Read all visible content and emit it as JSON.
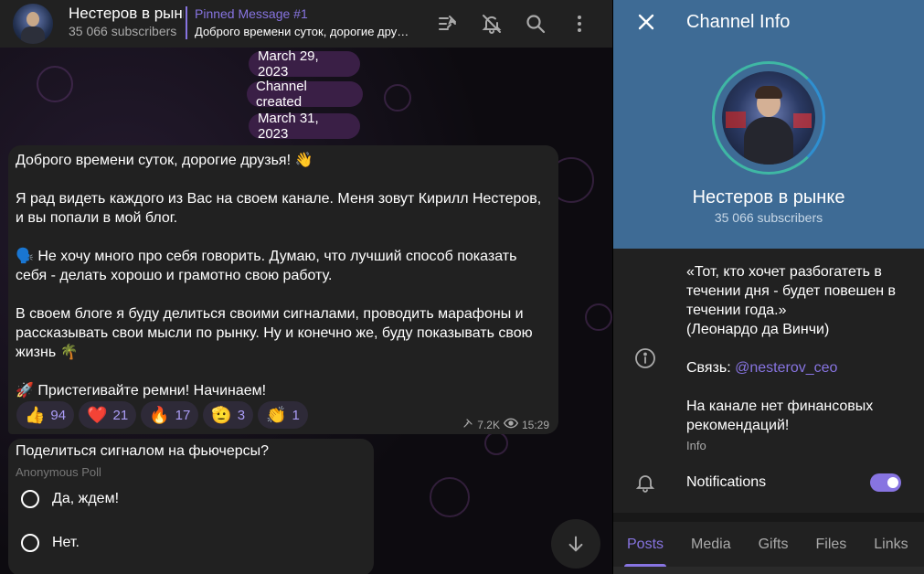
{
  "chat": {
    "header": {
      "title": "Нестеров в рынке",
      "subscribers": "35 066 subscribers",
      "pinned_title": "Pinned Message #1",
      "pinned_text": "Доброго времени суток, дорогие друзья! 👋"
    },
    "date_pills": [
      "March 29, 2023",
      "Channel created",
      "March 31, 2023"
    ],
    "message": {
      "lines": [
        "Доброго времени суток, дорогие друзья! 👋",
        "",
        "Я рад видеть каждого из Вас на своем канале. Меня зовут Кирилл Нестеров, и вы попали в мой блог.",
        "",
        "🗣️  Не хочу много про себя говорить. Думаю, что лучший способ показать себя - делать хорошо и грамотно свою работу.",
        "",
        "В своем блоге я буду делиться своими сигналами, проводить марафоны и рассказывать свои мысли по рынку. Ну и конечно же, буду показывать свою жизнь 🌴",
        "",
        "🚀  Пристегивайте ремни! Начинаем!"
      ],
      "reactions": [
        {
          "emoji": "👍",
          "count": "94"
        },
        {
          "emoji": "❤️",
          "count": "21"
        },
        {
          "emoji": "🔥",
          "count": "17"
        },
        {
          "emoji": "🫡",
          "count": "3"
        },
        {
          "emoji": "👏",
          "count": "1"
        }
      ],
      "shares": "7.2K",
      "time": "15:29"
    },
    "poll": {
      "question": "Поделиться сигналом на фьючерсы?",
      "type": "Anonymous Poll",
      "options": [
        "Да, ждем!",
        "Нет."
      ]
    }
  },
  "panel": {
    "title": "Channel Info",
    "name": "Нестеров в рынке",
    "subscribers": "35 066 subscribers",
    "bio_quote": "«Тот, кто хочет разбогатеть в течении дня - будет повешен в течении года.»",
    "bio_author": "(Леонардо да Винчи)",
    "contact_prefix": "Связь: ",
    "contact_link": "@nesterov_ceo",
    "disclaimer": "На канале нет финансовых рекомендаций!",
    "info_label": "Info",
    "notifications_label": "Notifications",
    "notifications_on": true,
    "tabs": [
      "Posts",
      "Media",
      "Gifts",
      "Files",
      "Links"
    ],
    "active_tab": "Posts"
  },
  "colors": {
    "accent": "#8774e1",
    "panel_header": "#3e6b95",
    "date_pill": "#3a1f46"
  }
}
